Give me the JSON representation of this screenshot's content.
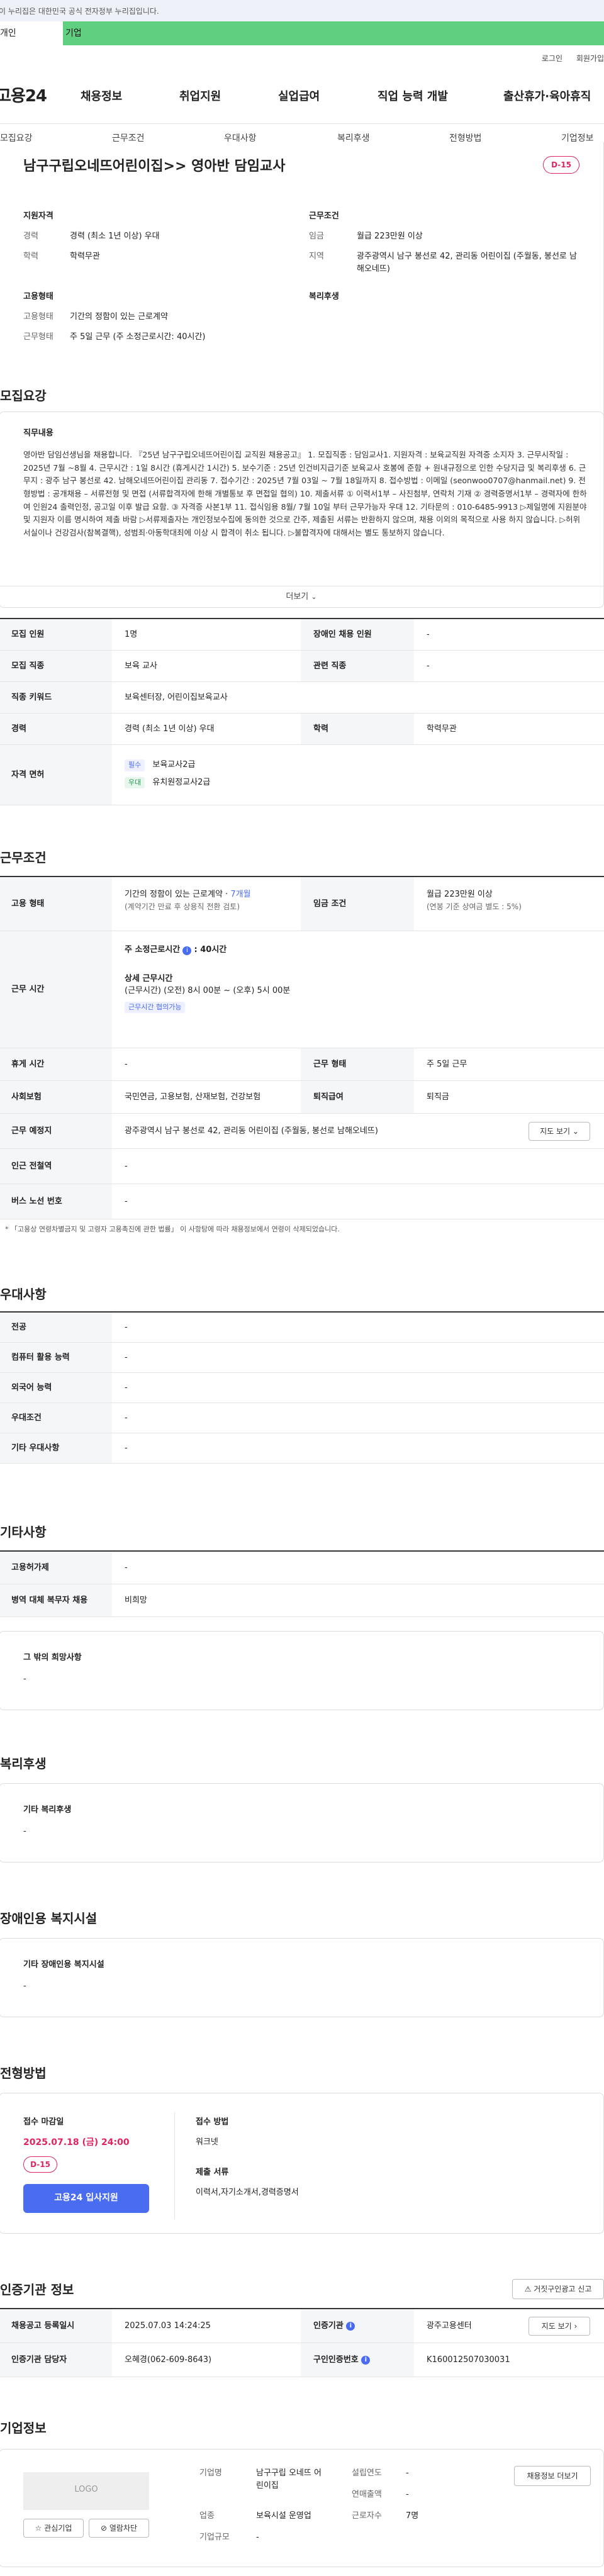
{
  "notice": "이 누리집은 대한민국 공식 전자정부 누리집입니다.",
  "audience_tabs": {
    "person": "개인",
    "company": "기업"
  },
  "util": {
    "login": "로그인",
    "join": "회원가입"
  },
  "logo": "고용24",
  "gnb": [
    "채용정보",
    "취업지원",
    "실업급여",
    "직업 능력 개발",
    "출산휴가·육아휴직"
  ],
  "subnav": [
    "모집요강",
    "근무조건",
    "우대사항",
    "복리후생",
    "전형방법",
    "기업정보"
  ],
  "job": {
    "title": "남구구립오네뜨어린이집>> 영아반 담임교사",
    "dday": "D-15",
    "qualification_title": "지원자격",
    "career_label": "경력",
    "career_value": "경력 (최소 1년 이상) 우대",
    "education_label": "학력",
    "education_value": "학력무관",
    "conditions_title": "근무조건",
    "wage_label": "임금",
    "wage_value": "월급 223만원 이상",
    "region_label": "지역",
    "region_value": "광주광역시 남구 봉선로 42, 관리동 어린이집 (주월동, 봉선로 남해오네뜨)",
    "employment_title": "고용형태",
    "emp_type_label": "고용형태",
    "emp_type_value": "기간의 정함이 있는 근로계약",
    "work_type_label": "근무형태",
    "work_type_value": "주 5일 근무 (주 소정근로시간: 40시간)",
    "welfare_title": "복리후생"
  },
  "recruit": {
    "section_title": "모집요강",
    "desc_title": "직무내용",
    "desc_text": "영아반 담임선생님을 채용합니다. 『25년 남구구립오네뜨어린이집 교직원 채용공고』 1. 모집직종 : 담임교사1. 지원자격 : 보육교직원 자격증 소지자 3. 근무시작일 : 2025년 7월 ~8월 4. 근무시간 : 1일 8시간 (휴게시간 1시간) 5. 보수기준 : 25년 인건비지급기준 보육교사 호봉에 준함 + 원내규정으로 인한 수당지급 및 복리후생 6. 근무지 : 광주 남구 봉선로 42. 남해오네뜨어린이집 관리동 7. 접수기간 : 2025년 7월 03일 ~ 7월 18일까지 8. 접수방법 : 이메일 (seonwoo0707@hanmail.net) 9. 전형방법 : 공개채용 – 서류전형 및 면접 (서류합격자에 한해 개별통보 후 면접일 협의) 10. 제출서류 ① 이력서1부 – 사진첨부, 연락처 기재 ② 경력증명서1부 – 경력자에 한하여 인원24 출력인정, 공고일 이후 발급 요함. ③ 자격증 사본1부 11. 접식임용 8월/ 7월 10일 부터 근무가능자 우대 12. 기타문의 : 010-6485-9913 ▷제일명에 지원분야 및 지원자 이름 명시하여 제출 바람 ▷서류제출자는 개인정보수집에 동의한 것으로 간주, 제출된 서류는 반환하지 않으며, 채용 이외의 목적으로 사용 하지 않습니다. ▷허위 서실이나 건강검사(참복결핵), 성범죄·아동학대죄에 이상 시 합격이 취소 됩니다. ▷불합격자에 대해서는 별도 통보하지 않습니다.",
    "more": "더보기",
    "rows": [
      {
        "k1": "모집 인원",
        "v1": "1명",
        "k2": "장애인 채용 인원",
        "v2": "-"
      },
      {
        "k1": "모집 직종",
        "v1": "보육 교사",
        "k2": "관련 직종",
        "v2": "-"
      },
      {
        "k1": "직종 키워드",
        "v1": "보육센터장, 어린이집보육교사"
      },
      {
        "k1": "경력",
        "v1": "경력 (최소 1년 이상) 우대",
        "k2": "학력",
        "v2": "학력무관"
      }
    ],
    "license_label": "자격 면허",
    "licenses": [
      {
        "tag": "필수",
        "name": "보육교사2급"
      },
      {
        "tag": "우대",
        "name": "유치원정교사2급"
      }
    ]
  },
  "conditions": {
    "section_title": "근무조건",
    "emp_label": "고용 형태",
    "emp_value_pre": "기간의 정함이 있는 근로계약 · ",
    "emp_value_months": "7개월",
    "emp_sub": "(계약기간 만료 후 상용직 전환 검토)",
    "wage_label": "임금 조건",
    "wage_value": "월급 223만원 이상",
    "wage_sub": "(연봉 기준 상여금 별도 : 5%)",
    "hours_label": "근무 시간",
    "weekly_title": "주 소정근로시간",
    "weekly_value": ": 40시간",
    "detail_title": "상세 근무시간",
    "detail_value": "(근무시간) (오전) 8시 00분 ~ (오후) 5시 00분",
    "detail_tag": "근무시간 협의가능",
    "rows": [
      {
        "k1": "휴게 시간",
        "v1": "-",
        "k2": "근무 형태",
        "v2": "주 5일 근무"
      },
      {
        "k1": "사회보험",
        "v1": "국민연금, 고용보험, 산재보험, 건강보험",
        "k2": "퇴직급여",
        "v2": "퇴직금"
      }
    ],
    "location_label": "근무 예정지",
    "location_value": "광주광역시 남구 봉선로 42, 관리동 어린이집 (주월동, 봉선로 남해오네뜨)",
    "map_btn": "지도 보기",
    "subway_label": "인근 전철역",
    "subway_value": "-",
    "bus_label": "버스 노선 번호",
    "bus_value": "-",
    "footnote": "* 「고용상 연령차별금지 및 고령자 고용촉진에 관한 법률」 이 사항탕에 따라 채용정보에서 연령이 삭제되었습니다."
  },
  "preference": {
    "section_title": "우대사항",
    "rows": [
      {
        "k": "전공",
        "v": "-"
      },
      {
        "k": "컴퓨터 활용 능력",
        "v": "-"
      },
      {
        "k": "외국어 능력",
        "v": "-"
      },
      {
        "k": "우대조건",
        "v": "-"
      },
      {
        "k": "기타 우대사항",
        "v": "-"
      }
    ]
  },
  "etc": {
    "section_title": "기타사항",
    "rows": [
      {
        "k": "고용허가제",
        "v": "-"
      },
      {
        "k": "병역 대체 복무자 채용",
        "v": "비희망"
      }
    ],
    "other_title": "그 밖의 희망사항",
    "other_value": "-"
  },
  "welfare": {
    "section_title": "복리후생",
    "box_title": "기타 복리후생",
    "box_value": "-"
  },
  "disability": {
    "section_title": "장애인용 복지시설",
    "box_title": "기타 장애인용 복지시설",
    "box_value": "-"
  },
  "selection": {
    "section_title": "전형방법",
    "deadline_label": "접수 마감일",
    "deadline_value": "2025.07.18 (금) 24:00",
    "dday": "D-15",
    "apply_btn": "고용24 입사지원",
    "method_label": "접수 방법",
    "method_value": "워크넷",
    "docs_label": "제출 서류",
    "docs_value": "이력서,자기소개서,경력증명서"
  },
  "cert": {
    "section_title": "인증기관 정보",
    "report_btn": "거짓구인광고 신고",
    "rows": [
      {
        "k1": "채용공고 등록일시",
        "v1": "2025.07.03 14:24:25",
        "k2": "인증기관",
        "v2": "광주고용센터"
      },
      {
        "k1": "인증기관 담당자",
        "v1": "오혜경(062-609-8643)",
        "k2": "구인인증번호",
        "v2": "K160012507030031"
      }
    ],
    "map_btn": "지도 보기"
  },
  "company": {
    "section_title": "기업정보",
    "logo_placeholder": "LOGO",
    "interest_btn": "관심기업",
    "block_btn": "열람차단",
    "name_label": "기업명",
    "name_value": "남구구립 오네뜨 어린이집",
    "industry_label": "업종",
    "industry_value": "보육시설 운영업",
    "size_label": "기업규모",
    "size_value": "-",
    "founded_label": "설립연도",
    "founded_value": "-",
    "sales_label": "연매출액",
    "sales_value": "-",
    "employees_label": "근로자수",
    "employees_value": "7명",
    "jobs_btn": "채용정보 더보기"
  }
}
